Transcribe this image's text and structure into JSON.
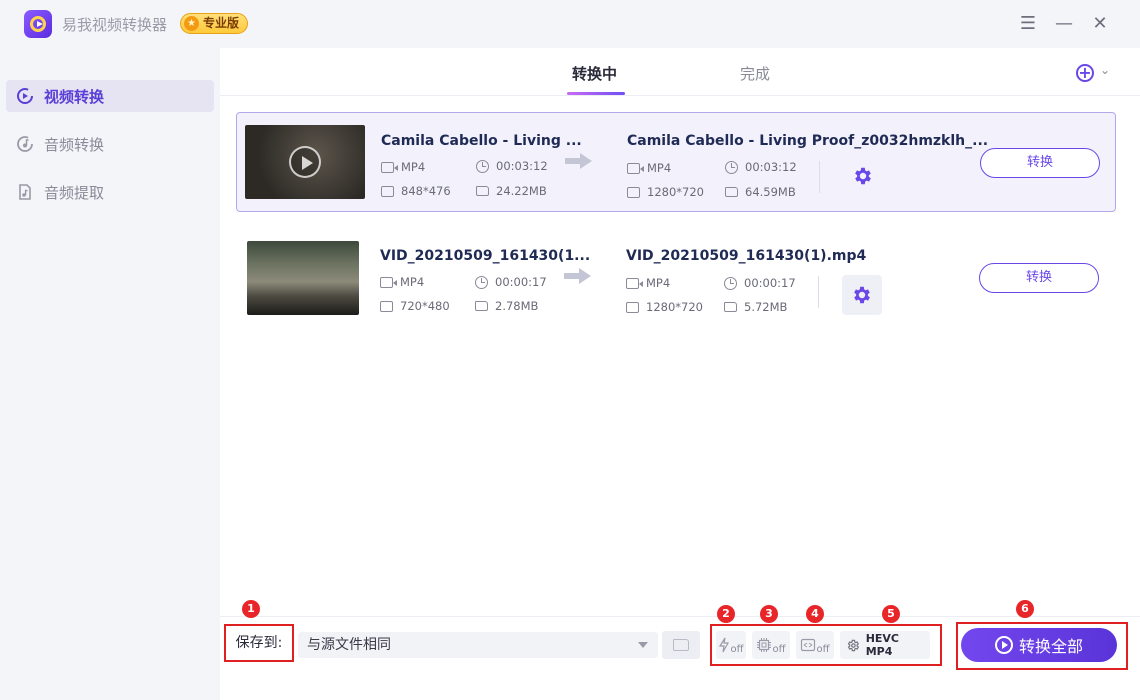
{
  "app": {
    "title": "易我视频转换器",
    "badge": "专业版"
  },
  "window_controls": {
    "menu": "☰",
    "minimize": "—",
    "close": "✕"
  },
  "sidebar": {
    "items": [
      {
        "label": "视频转换",
        "icon": "video-convert-icon",
        "active": true
      },
      {
        "label": "音频转换",
        "icon": "audio-convert-icon",
        "active": false
      },
      {
        "label": "音频提取",
        "icon": "audio-extract-icon",
        "active": false
      }
    ]
  },
  "tabs": [
    {
      "label": "转换中",
      "active": true
    },
    {
      "label": "完成",
      "active": false
    }
  ],
  "files": [
    {
      "source": {
        "name": "Camila Cabello - Living ...",
        "format": "MP4",
        "duration": "00:03:12",
        "resolution": "848*476",
        "size": "24.22MB"
      },
      "output": {
        "name": "Camila Cabello - Living Proof_z0032hmzklh_...",
        "format": "MP4",
        "duration": "00:03:12",
        "resolution": "1280*720",
        "size": "64.59MB"
      },
      "button": "转换",
      "selected": true
    },
    {
      "source": {
        "name": "VID_20210509_161430(1...",
        "format": "MP4",
        "duration": "00:00:17",
        "resolution": "720*480",
        "size": "2.78MB"
      },
      "output": {
        "name": "VID_20210509_161430(1).mp4",
        "format": "MP4",
        "duration": "00:00:17",
        "resolution": "1280*720",
        "size": "5.72MB"
      },
      "button": "转换",
      "selected": false
    }
  ],
  "bottom": {
    "save_label": "保存到:",
    "save_path": "与源文件相同",
    "tools": {
      "off_label": "off",
      "format_label": "HEVC MP4"
    },
    "convert_all": "转换全部",
    "markers": [
      "1",
      "2",
      "3",
      "4",
      "5",
      "6"
    ]
  },
  "colors": {
    "accent": "#6a48e8",
    "marker_red": "#e8262a"
  }
}
